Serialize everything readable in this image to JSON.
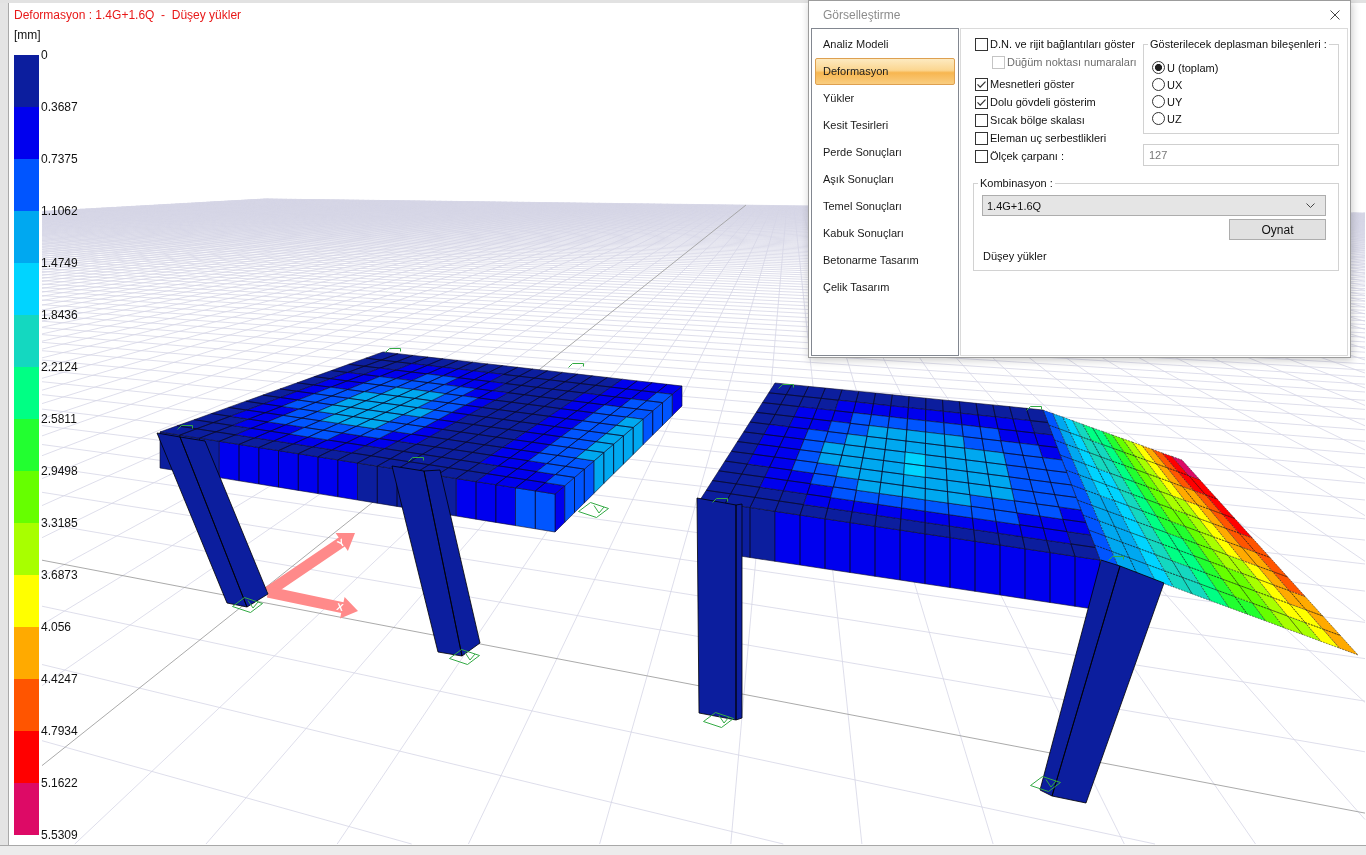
{
  "viewport": {
    "title": "Deformasyon : 1.4G+1.6Q  -  Düşey yükler",
    "unit": "[mm]",
    "legend": {
      "labels": [
        "0",
        "0.3687",
        "0.7375",
        "1.1062",
        "1.4749",
        "1.8436",
        "2.2124",
        "2.5811",
        "2.9498",
        "3.3185",
        "3.6873",
        "4.056",
        "4.4247",
        "4.7934",
        "5.1622",
        "5.5309"
      ],
      "bands": [
        {
          "color": "#0c1e9e"
        },
        {
          "color": "#0000ee"
        },
        {
          "color": "#0055ff"
        },
        {
          "color": "#00a8f0"
        },
        {
          "color": "#00d4ff"
        },
        {
          "color": "#14d8c0"
        },
        {
          "color": "#00ff84"
        },
        {
          "color": "#22ff30"
        },
        {
          "color": "#66ff00"
        },
        {
          "color": "#a8ff00"
        },
        {
          "color": "#ffff00"
        },
        {
          "color": "#ffaa00"
        },
        {
          "color": "#ff5500"
        },
        {
          "color": "#ff0000"
        },
        {
          "color": "#dd0a66"
        }
      ]
    },
    "axes": [
      {
        "label": "Y"
      },
      {
        "label": "X"
      }
    ]
  },
  "dialog": {
    "title": "Görselleştirme",
    "menu": [
      {
        "label": "Analiz Modeli",
        "selected": false
      },
      {
        "label": "Deformasyon",
        "selected": true
      },
      {
        "label": "Yükler",
        "selected": false
      },
      {
        "label": "Kesit Tesirleri",
        "selected": false
      },
      {
        "label": "Perde Sonuçları",
        "selected": false
      },
      {
        "label": "Aşık Sonuçları",
        "selected": false
      },
      {
        "label": "Temel Sonuçları",
        "selected": false
      },
      {
        "label": "Kabuk Sonuçları",
        "selected": false
      },
      {
        "label": "Betonarme Tasarım",
        "selected": false
      },
      {
        "label": "Çelik Tasarım",
        "selected": false
      }
    ],
    "options": [
      {
        "label": "D.N. ve rijit bağlantıları göster",
        "checked": false,
        "disabled": false,
        "children": [
          {
            "label": "Düğüm noktası numaraları",
            "checked": false,
            "disabled": true
          }
        ]
      },
      {
        "label": "Mesnetleri göster",
        "checked": true,
        "disabled": false
      },
      {
        "label": "Dolu gövdeli gösterim",
        "checked": true,
        "disabled": false
      },
      {
        "label": "Sıcak bölge skalası",
        "checked": false,
        "disabled": false
      },
      {
        "label": "Eleman uç serbestlikleri",
        "checked": false,
        "disabled": false
      },
      {
        "label": "Ölçek çarpanı :",
        "checked": false,
        "disabled": false
      }
    ],
    "displacement_group": {
      "title": "Gösterilecek deplasman bileşenleri :",
      "options": [
        {
          "label": "U (toplam)",
          "selected": true
        },
        {
          "label": "UX",
          "selected": false
        },
        {
          "label": "UY",
          "selected": false
        },
        {
          "label": "UZ",
          "selected": false
        }
      ]
    },
    "scale_field": {
      "value": "127",
      "disabled": true
    },
    "combination_group": {
      "title": "Kombinasyon :",
      "dropdown": {
        "value": "1.4G+1.6Q"
      },
      "play_button": "Oynat",
      "description": "Düşey yükler"
    }
  }
}
